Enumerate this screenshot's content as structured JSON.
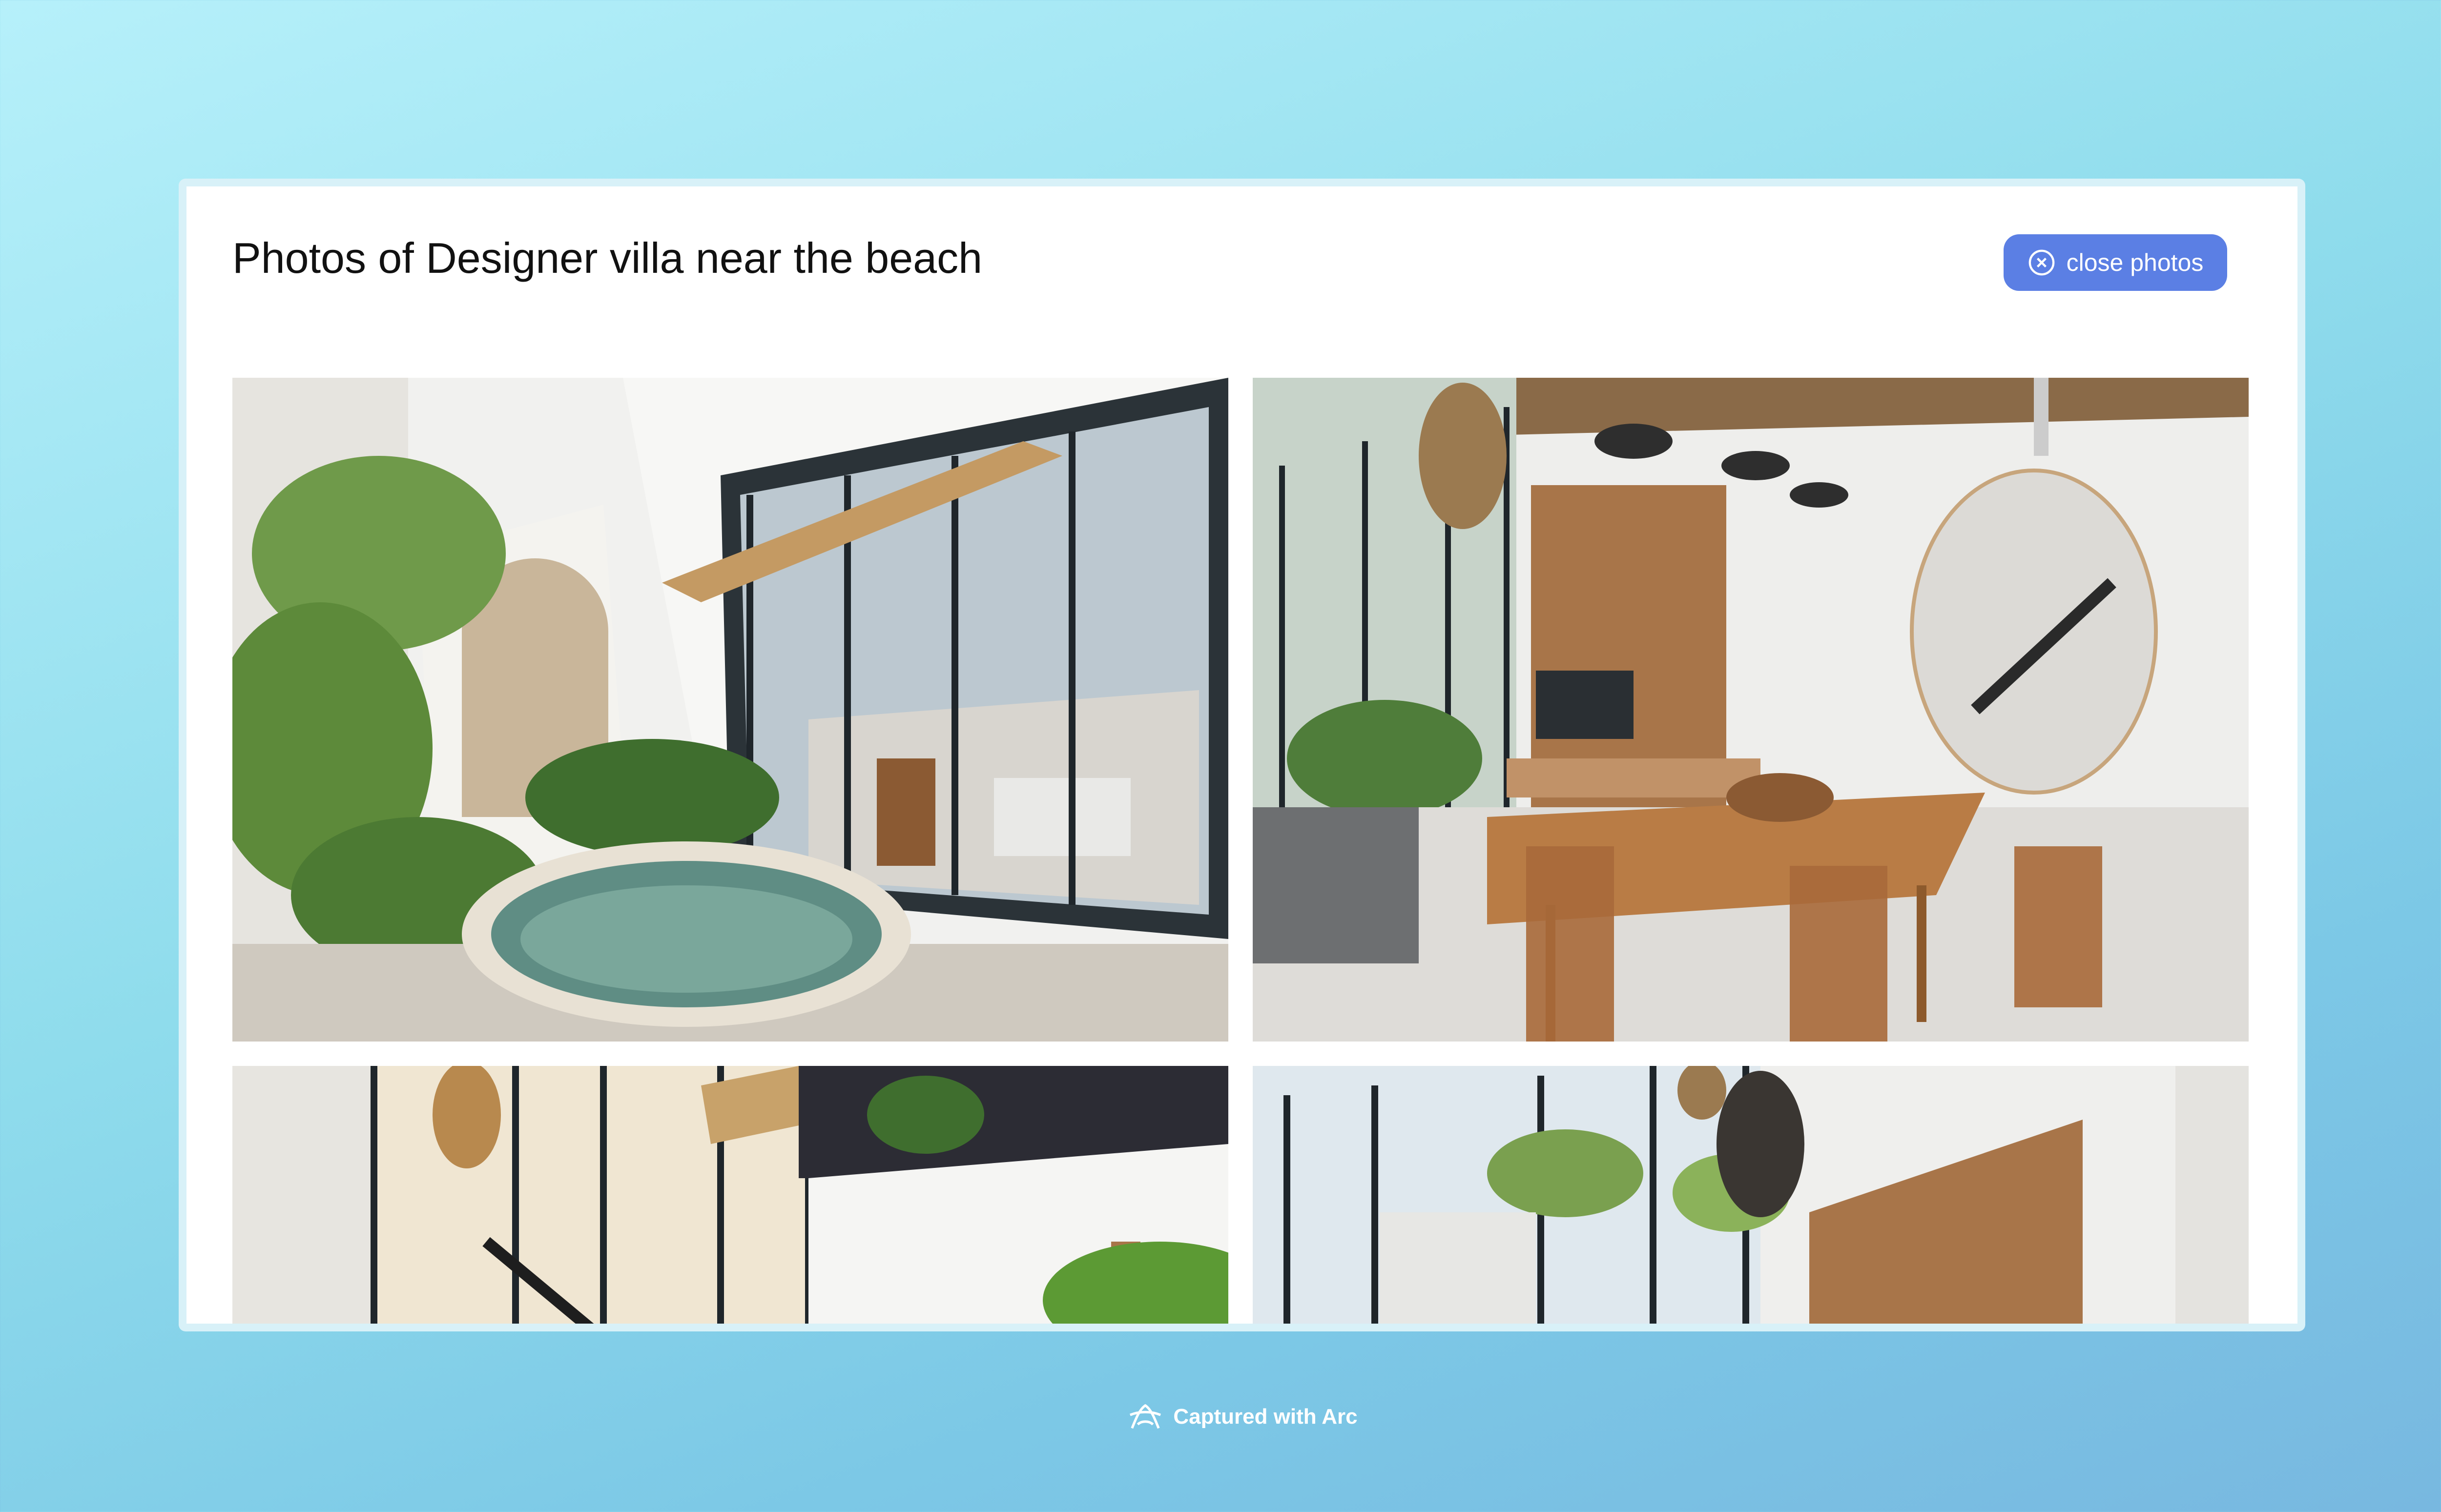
{
  "header": {
    "title": "Photos of Designer villa near the beach",
    "close_label": "close photos",
    "close_icon": "close-circle-icon",
    "accent": "#5b7fe4"
  },
  "photos": [
    {
      "alt": "Plunge pool courtyard with glass facade"
    },
    {
      "alt": "Living and dining room with wooden table"
    },
    {
      "alt": "Double-height facade with rattan pendant"
    },
    {
      "alt": "Interior with black-framed windows and wood panel"
    }
  ],
  "footer": {
    "text": "Captured with Arc",
    "icon": "arc-logo-icon"
  }
}
